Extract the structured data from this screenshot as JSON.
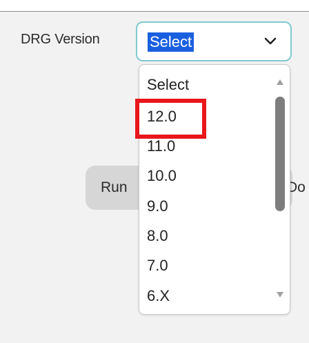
{
  "form": {
    "drg_label": "DRG Version",
    "selected_value": "Select",
    "run_label": "Run",
    "doc_label": "Do"
  },
  "dropdown": {
    "options": [
      "Select",
      "12.0",
      "11.0",
      "10.0",
      "9.0",
      "8.0",
      "7.0",
      "6.X"
    ],
    "highlighted_option": "12.0"
  },
  "colors": {
    "selection_bg": "#1a5fe0",
    "focus_border": "#7fc9d0",
    "highlight_box": "#e8171b",
    "scroll_thumb": "#7d7d7d"
  },
  "icons": {
    "dropdown_chevron": "chevron-down-icon",
    "scroll_up": "scroll-up-arrow-icon",
    "scroll_down": "scroll-down-arrow-icon"
  }
}
